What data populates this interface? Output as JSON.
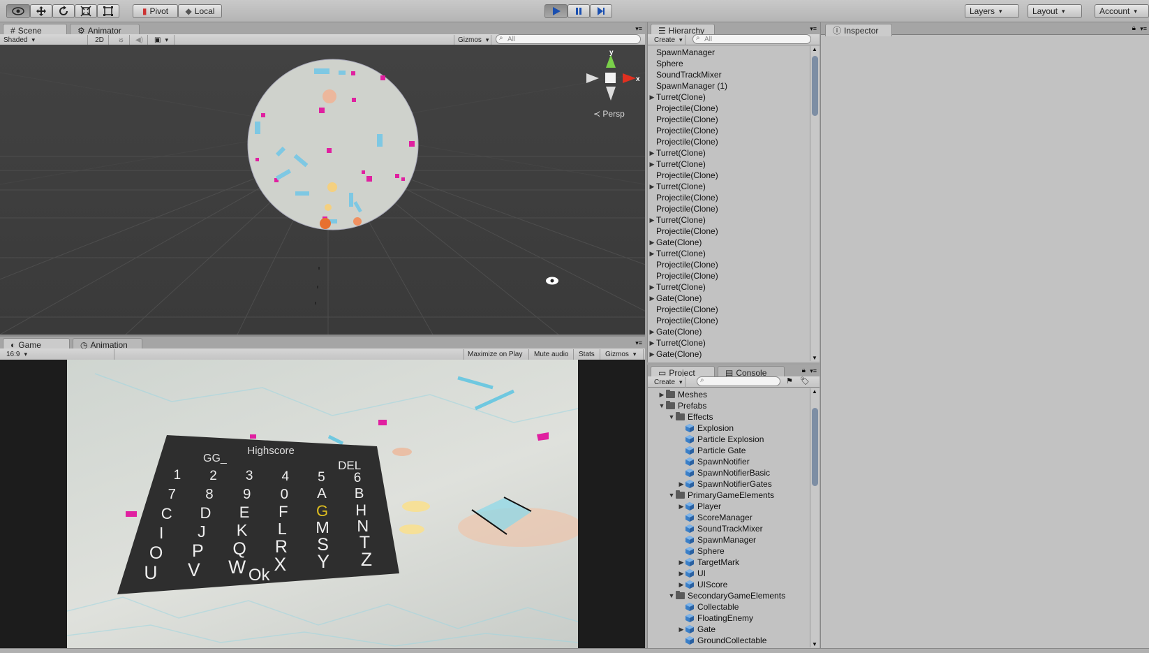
{
  "toolbar": {
    "pivot": "Pivot",
    "local": "Local",
    "layers": "Layers",
    "layout": "Layout",
    "account": "Account"
  },
  "scene": {
    "tab_scene": "Scene",
    "tab_animator": "Animator",
    "shading_mode": "Shaded",
    "btn_2d": "2D",
    "gizmos": "Gizmos",
    "search_placeholder": "All",
    "gizmo_y": "y",
    "gizmo_x": "x",
    "persp": "Persp"
  },
  "game": {
    "tab_game": "Game",
    "tab_animation": "Animation",
    "aspect": "16:9",
    "maximize_on_play": "Maximize on Play",
    "mute_audio": "Mute audio",
    "stats": "Stats",
    "gizmos": "Gizmos",
    "keyboard": {
      "title": "Highscore",
      "entry": "GG_",
      "del": "DEL",
      "rows": [
        [
          "1",
          "2",
          "3",
          "4",
          "5",
          "6"
        ],
        [
          "7",
          "8",
          "9",
          "0",
          "A",
          "B"
        ],
        [
          "C",
          "D",
          "E",
          "F",
          "G",
          "H"
        ],
        [
          "I",
          "J",
          "K",
          "L",
          "M",
          "N"
        ],
        [
          "O",
          "P",
          "Q",
          "R",
          "S",
          "T"
        ],
        [
          "U",
          "V",
          "W",
          "X",
          "Y",
          "Z"
        ]
      ],
      "highlight": "G",
      "ok": "Ok"
    }
  },
  "hierarchy": {
    "tab": "Hierarchy",
    "create": "Create",
    "search_placeholder": "All",
    "items": [
      {
        "label": "SpawnManager",
        "expandable": false
      },
      {
        "label": "Sphere",
        "expandable": false
      },
      {
        "label": "SoundTrackMixer",
        "expandable": false
      },
      {
        "label": "SpawnManager (1)",
        "expandable": false
      },
      {
        "label": "Turret(Clone)",
        "expandable": true
      },
      {
        "label": "Projectile(Clone)",
        "expandable": false
      },
      {
        "label": "Projectile(Clone)",
        "expandable": false
      },
      {
        "label": "Projectile(Clone)",
        "expandable": false
      },
      {
        "label": "Projectile(Clone)",
        "expandable": false
      },
      {
        "label": "Turret(Clone)",
        "expandable": true
      },
      {
        "label": "Turret(Clone)",
        "expandable": true
      },
      {
        "label": "Projectile(Clone)",
        "expandable": false
      },
      {
        "label": "Turret(Clone)",
        "expandable": true
      },
      {
        "label": "Projectile(Clone)",
        "expandable": false
      },
      {
        "label": "Projectile(Clone)",
        "expandable": false
      },
      {
        "label": "Turret(Clone)",
        "expandable": true
      },
      {
        "label": "Projectile(Clone)",
        "expandable": false
      },
      {
        "label": "Gate(Clone)",
        "expandable": true
      },
      {
        "label": "Turret(Clone)",
        "expandable": true
      },
      {
        "label": "Projectile(Clone)",
        "expandable": false
      },
      {
        "label": "Projectile(Clone)",
        "expandable": false
      },
      {
        "label": "Turret(Clone)",
        "expandable": true
      },
      {
        "label": "Gate(Clone)",
        "expandable": true
      },
      {
        "label": "Projectile(Clone)",
        "expandable": false
      },
      {
        "label": "Projectile(Clone)",
        "expandable": false
      },
      {
        "label": "Gate(Clone)",
        "expandable": true
      },
      {
        "label": "Turret(Clone)",
        "expandable": true
      },
      {
        "label": "Gate(Clone)",
        "expandable": true
      }
    ]
  },
  "project": {
    "tab_project": "Project",
    "tab_console": "Console",
    "create": "Create",
    "tree": [
      {
        "label": "Meshes",
        "depth": 0,
        "type": "folder",
        "state": "collapsed"
      },
      {
        "label": "Prefabs",
        "depth": 0,
        "type": "folder",
        "state": "expanded"
      },
      {
        "label": "Effects",
        "depth": 1,
        "type": "folder",
        "state": "expanded"
      },
      {
        "label": "Explosion",
        "depth": 2,
        "type": "prefab",
        "state": "none"
      },
      {
        "label": "Particle Explosion",
        "depth": 2,
        "type": "prefab",
        "state": "none"
      },
      {
        "label": "Particle Gate",
        "depth": 2,
        "type": "prefab",
        "state": "none"
      },
      {
        "label": "SpawnNotifier",
        "depth": 2,
        "type": "prefab",
        "state": "none"
      },
      {
        "label": "SpawnNotifierBasic",
        "depth": 2,
        "type": "prefab",
        "state": "none"
      },
      {
        "label": "SpawnNotifierGates",
        "depth": 2,
        "type": "prefab",
        "state": "collapsed"
      },
      {
        "label": "PrimaryGameElements",
        "depth": 1,
        "type": "folder",
        "state": "expanded"
      },
      {
        "label": "Player",
        "depth": 2,
        "type": "prefab",
        "state": "collapsed"
      },
      {
        "label": "ScoreManager",
        "depth": 2,
        "type": "prefab",
        "state": "none"
      },
      {
        "label": "SoundTrackMixer",
        "depth": 2,
        "type": "prefab",
        "state": "none"
      },
      {
        "label": "SpawnManager",
        "depth": 2,
        "type": "prefab",
        "state": "none"
      },
      {
        "label": "Sphere",
        "depth": 2,
        "type": "prefab",
        "state": "none"
      },
      {
        "label": "TargetMark",
        "depth": 2,
        "type": "prefab",
        "state": "collapsed"
      },
      {
        "label": "UI",
        "depth": 2,
        "type": "prefab",
        "state": "collapsed"
      },
      {
        "label": "UIScore",
        "depth": 2,
        "type": "prefab",
        "state": "collapsed"
      },
      {
        "label": "SecondaryGameElements",
        "depth": 1,
        "type": "folder",
        "state": "expanded"
      },
      {
        "label": "Collectable",
        "depth": 2,
        "type": "prefab",
        "state": "none"
      },
      {
        "label": "FloatingEnemy",
        "depth": 2,
        "type": "prefab",
        "state": "none"
      },
      {
        "label": "Gate",
        "depth": 2,
        "type": "prefab",
        "state": "collapsed"
      },
      {
        "label": "GroundCollectable",
        "depth": 2,
        "type": "prefab",
        "state": "none"
      }
    ]
  },
  "inspector": {
    "tab": "Inspector"
  },
  "colors": {
    "accent_play": "#5a8fd0",
    "highlight_key": "#e0c020",
    "projectile": "#e020a0"
  }
}
